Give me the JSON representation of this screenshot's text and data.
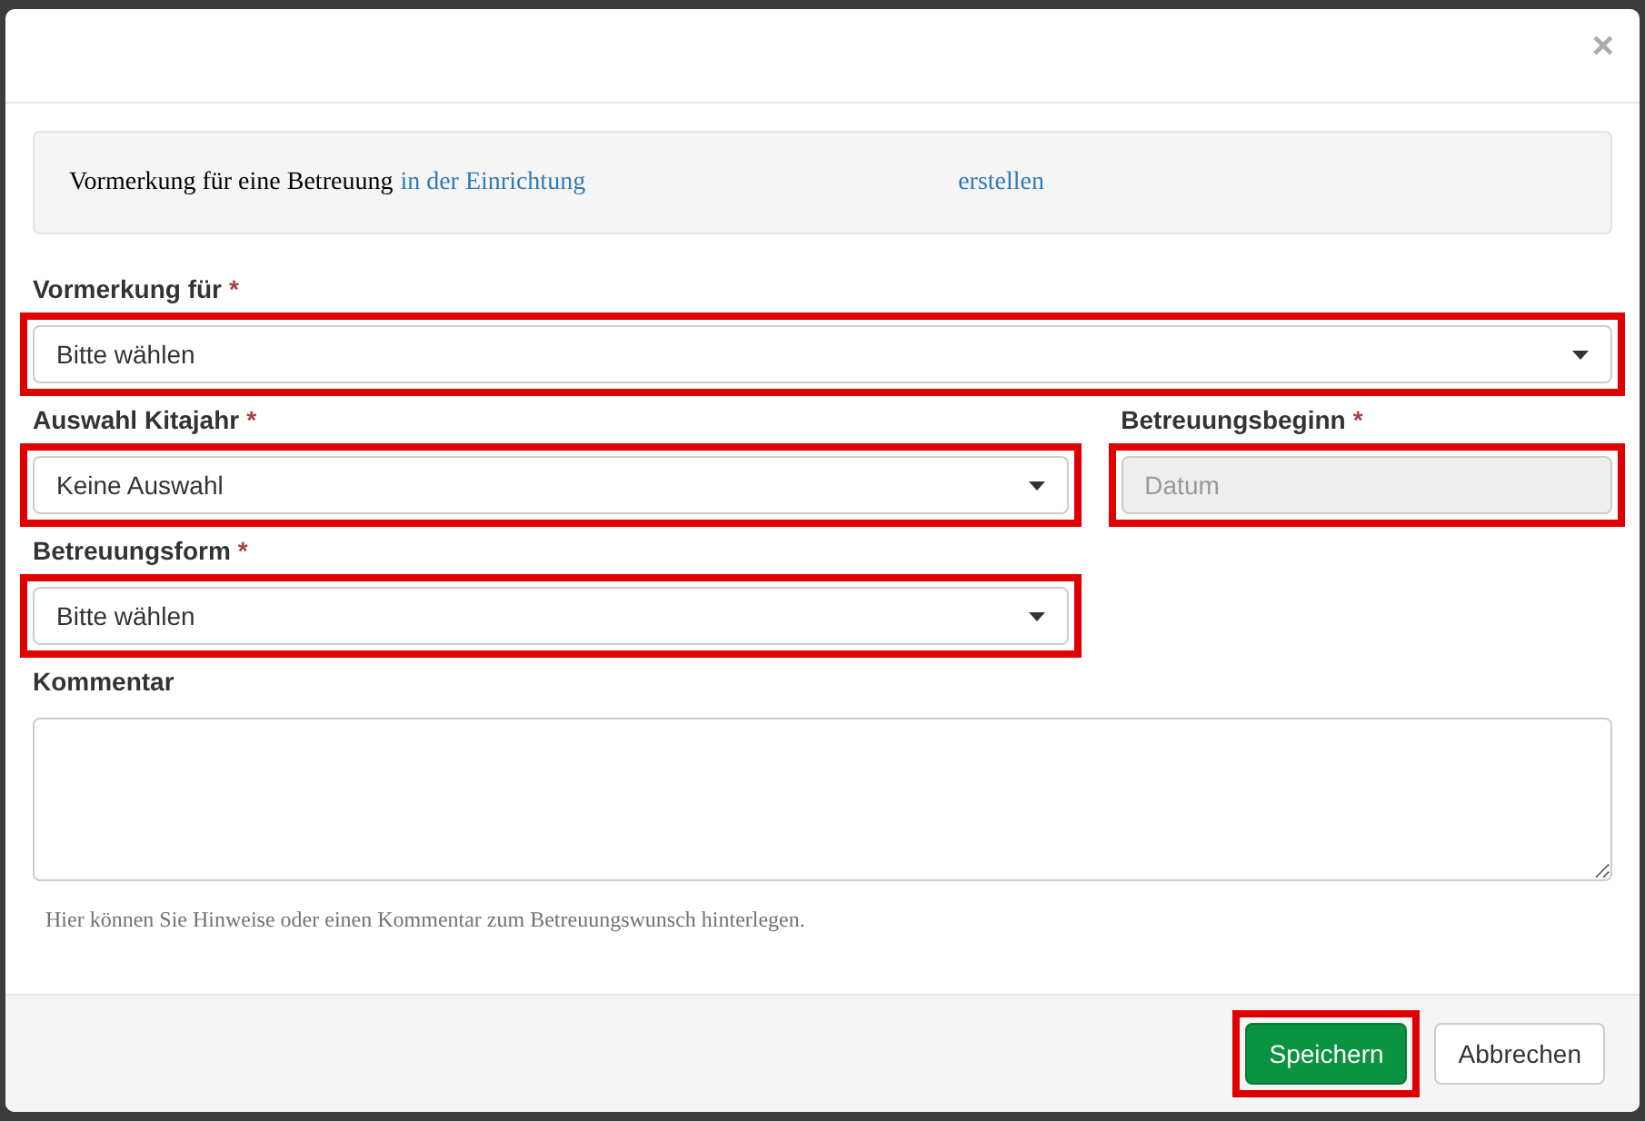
{
  "modal": {
    "close": "×",
    "info": {
      "text": "Vormerkung für eine Betreuung",
      "facility_link": "in der Einrichtung",
      "create_link": "erstellen"
    },
    "fields": [
      {
        "kind": "select",
        "label": "Vormerkung für",
        "required": "*",
        "value": "Bitte wählen",
        "highlighted": true
      },
      {
        "kind": "select",
        "label": "Auswahl Kitajahr",
        "required": "*",
        "value": "Keine Auswahl",
        "highlighted": true
      },
      {
        "kind": "date",
        "label": "Betreuungsbeginn",
        "required": "*",
        "placeholder": "Datum",
        "highlighted": true,
        "disabled": true
      },
      {
        "kind": "select",
        "label": "Betreuungsform",
        "required": "*",
        "value": "Bitte wählen",
        "highlighted": true
      },
      {
        "kind": "textarea",
        "label": "Kommentar",
        "highlighted": false,
        "help": "Hier können Sie Hinweise oder einen Kommentar zum Betreuungswunsch hinterlegen."
      }
    ],
    "buttons": [
      {
        "kind": "primary",
        "label": "Speichern",
        "highlighted": true
      },
      {
        "kind": "default",
        "label": "Abbrechen",
        "highlighted": false
      }
    ]
  }
}
